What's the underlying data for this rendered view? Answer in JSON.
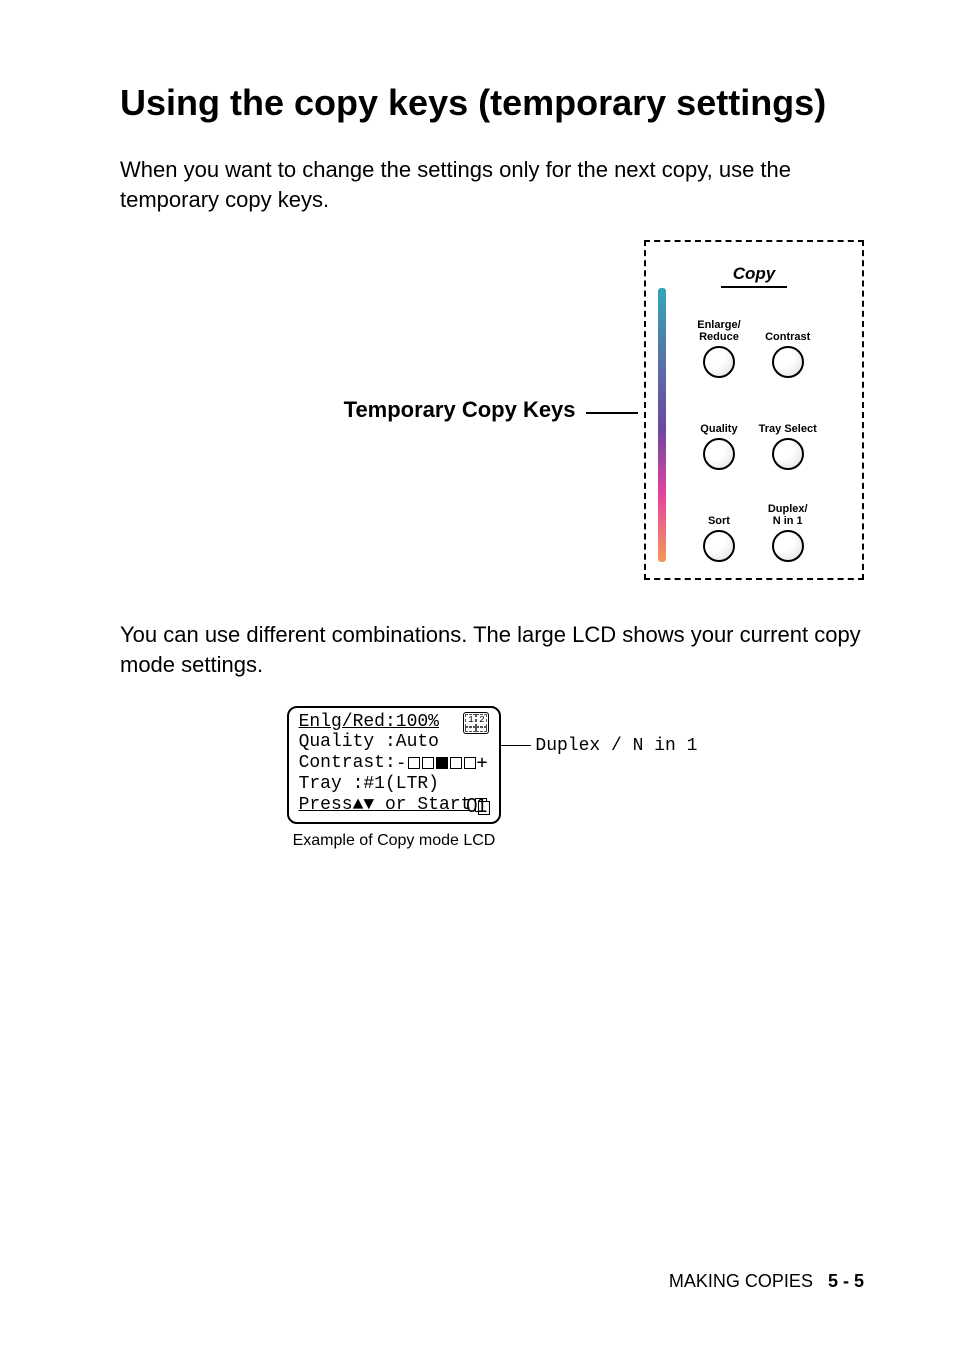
{
  "heading": "Using the copy keys (temporary settings)",
  "intro": "When you want to change the settings only for the next copy, use the temporary copy keys.",
  "panel": {
    "caption": "Temporary Copy Keys",
    "header": "Copy",
    "keys": {
      "col1": [
        {
          "label": "Enlarge/\nReduce"
        },
        {
          "label": "Quality"
        },
        {
          "label": "Sort"
        }
      ],
      "col2": [
        {
          "label": "Contrast"
        },
        {
          "label": "Tray Select"
        },
        {
          "label": "Duplex/\nN in 1"
        }
      ]
    }
  },
  "para2": "You can use different combinations. The large LCD shows your current copy mode settings.",
  "lcd": {
    "line1": "Enlg/Red:100%",
    "line2": "Quality :Auto",
    "line3_label": "Contrast:",
    "line4": "Tray    :#1(LTR)",
    "line5a": "Press",
    "line5b": " or Start",
    "nin_cells": [
      "1",
      "2",
      "",
      ""
    ],
    "counter": "01",
    "annot": "Duplex / N in 1"
  },
  "lcd_caption": "Example of Copy mode LCD",
  "footer": {
    "section": "MAKING COPIES",
    "page": "5 - 5"
  }
}
